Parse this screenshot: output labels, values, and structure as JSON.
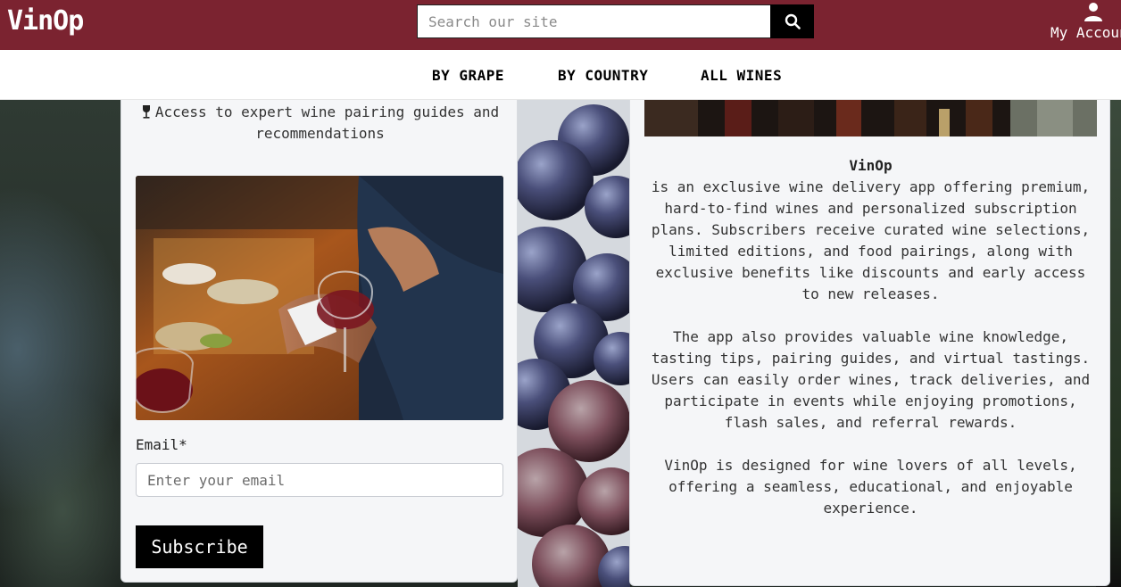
{
  "header": {
    "brand": "VinOp",
    "search_placeholder": "Search our site",
    "search_icon": "search-icon",
    "account_icon": "person-icon",
    "account_label": "My Account"
  },
  "nav": {
    "items": [
      {
        "label": "BY GRAPE"
      },
      {
        "label": "BY COUNTRY"
      },
      {
        "label": "ALL WINES"
      }
    ]
  },
  "signup": {
    "benefit_icon": "wine-glass-icon",
    "benefit_text": "Access to expert wine pairing guides and recommendations",
    "email_label": "Email*",
    "email_placeholder": "Enter your email",
    "subscribe_label": "Subscribe"
  },
  "about": {
    "title": "VinOp",
    "paragraph1": "is an exclusive wine delivery app offering premium, hard-to-find wines and personalized subscription plans. Subscribers receive curated wine selections, limited editions, and food pairings, along with exclusive benefits like discounts and early access to new releases.",
    "paragraph2": "The app also provides valuable wine knowledge, tasting tips, pairing guides, and virtual tastings. Users can easily order wines, track deliveries, and participate in events while enjoying promotions, flash sales, and referral rewards.",
    "paragraph3": "VinOp is designed for wine lovers of all levels, offering a seamless, educational, and enjoyable experience."
  },
  "colors": {
    "header_bg": "#7b2330",
    "button_bg": "#000000",
    "card_bg": "#f5f6f8"
  }
}
